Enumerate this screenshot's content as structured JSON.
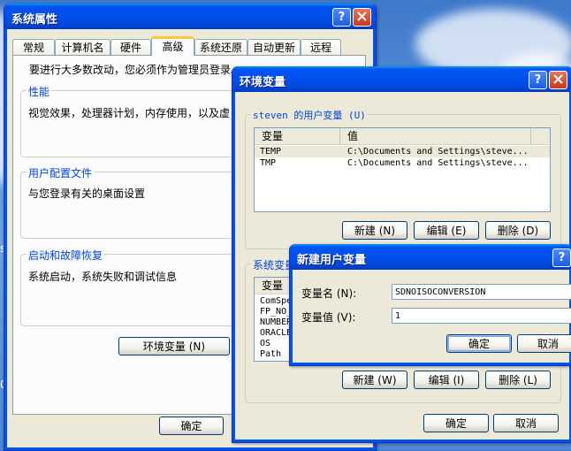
{
  "sysprops": {
    "title": "系统属性",
    "tabs": [
      "常规",
      "计算机名",
      "硬件",
      "高级",
      "系统还原",
      "自动更新",
      "远程"
    ],
    "admin_notice": "要进行大多数改动，您必须作为管理员登录。",
    "performance": {
      "legend": "性能",
      "desc": "视觉效果，处理器计划，内存使用，以及虚"
    },
    "user_profiles": {
      "legend": "用户配置文件",
      "desc": "与您登录有关的桌面设置"
    },
    "startup_recovery": {
      "legend": "启动和故障恢复",
      "desc": "系统启动，系统失败和调试信息"
    },
    "env_button": "环境变量 (N)",
    "ok_button": "确定"
  },
  "envvars": {
    "title": "环境变量",
    "user_group_legend": "steven 的用户变量 (U)",
    "columns": {
      "variable": "变量",
      "value": "值"
    },
    "user_vars": [
      {
        "name": "TEMP",
        "value": "C:\\Documents and Settings\\steve..."
      },
      {
        "name": "TMP",
        "value": "C:\\Documents and Settings\\steve..."
      }
    ],
    "user_buttons": {
      "new": "新建 (N)",
      "edit": "编辑 (E)",
      "delete": "删除 (D)"
    },
    "system_group_legend": "系统变量",
    "system_column": "变量",
    "system_vars": [
      "ComSpe",
      "FP_NO_",
      "NUMBER",
      "ORACLE",
      "OS",
      "Path"
    ],
    "system_buttons": {
      "new": "新建 (W)",
      "edit": "编辑 (I)",
      "delete": "删除 (L)"
    },
    "ok_button": "确定",
    "cancel_button": "取消"
  },
  "newvar": {
    "title": "新建用户变量",
    "name_label": "变量名 (N):",
    "name_value": "SDNOISOCONVERSION",
    "value_label": "变量值 (V):",
    "value_value": "1",
    "ok_button": "确定",
    "cancel_button": "取消"
  },
  "desktop": {
    "edge_glyph_top": "s",
    "edge_glyph_bottom": "0"
  }
}
